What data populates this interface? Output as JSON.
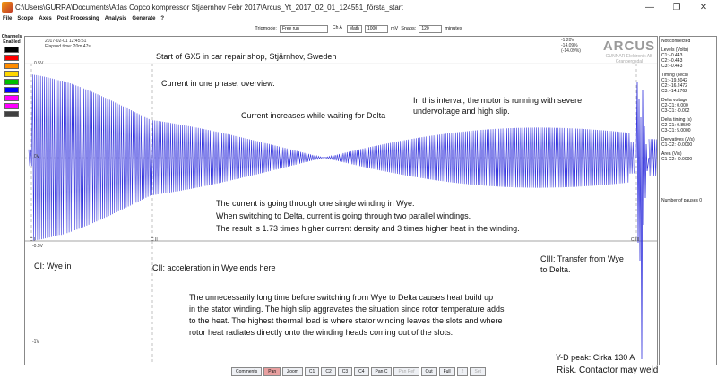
{
  "window": {
    "title": "C:\\Users\\GURRA\\Documents\\Atlas Copco kompressor Stjaernhov Febr 2017\\Arcus_Yt_2017_02_01_124551_första_start",
    "minimize": "—",
    "maximize": "❐",
    "close": "✕"
  },
  "menu": [
    "File",
    "Scope",
    "Axes",
    "Post Processing",
    "Analysis",
    "Generate",
    "?"
  ],
  "toolbar": {
    "trigmode_label": "Trigmode:",
    "trigmode_value": "Free run",
    "channel_value": "Ch A",
    "math_value": "Math",
    "level_value": "1000",
    "level_unit": "mV",
    "snaps_label": "Snaps:",
    "snaps_value": "120",
    "snaps_unit": "minutes"
  },
  "channels": {
    "header1": "Channels",
    "header2": "Enabled",
    "colors": [
      "#000000",
      "#ff0000",
      "#ff8c00",
      "#ffd700",
      "#00c000",
      "#0000ff",
      "#ff00ff",
      "#ff00ff",
      "#404040"
    ]
  },
  "plot": {
    "timestamp": "2017-02-01   12:45:51",
    "elapsed": "Elapsed time: 20m 47s",
    "scale_top": "0.5V",
    "scale_zero": "0V",
    "scale_bottom": "-0.5V",
    "scale_mid": "-1V",
    "top_right_readout_1": "-1.20V",
    "top_right_readout_2": "-14.09%",
    "top_right_readout_3": "(-14.09%)",
    "cursor_1": "C I",
    "cursor_2": "C II",
    "cursor_3": "C III",
    "signal_color": "#3333dd"
  },
  "logo": {
    "title": "ARCUS",
    "sub1": "GUNNAR Elektronik AB",
    "sub2": "Granbergsdal"
  },
  "annotations": {
    "a1": "Start of GX5 in car repair shop, Stjärnhov, Sweden",
    "a2": "Current in one phase, overview.",
    "a3": "Current increases while waiting for Delta",
    "a4_l1": "In this interval, the motor is running with severe",
    "a4_l2": "undervoltage and high slip.",
    "a5_l1": "The current is going through one single winding in Wye.",
    "a5_l2": "When switching to Delta, current is going through two parallel windings.",
    "a5_l3": "The result is 1.73 times higher current density and 3 times higher heat in the winding.",
    "ci": "CI: Wye in",
    "cii": "CII: acceleration in Wye ends here",
    "ciii_l1": "CIII: Transfer from Wye",
    "ciii_l2": "to Delta.",
    "a6_l1": "The unnecessarily long time before switching from Wye to Delta causes heat build up",
    "a6_l2": "in the stator winding. The high slip aggravates the situation since rotor temperature adds",
    "a6_l3": "to the heat. The highest thermal load is where stator winding leaves the slots and where",
    "a6_l4": "rotor heat radiates directly onto the winding heads coming out of the slots.",
    "yd_peak": "Y-D peak: Cirka 130 A",
    "risk": "Risk. Contactor may weld"
  },
  "rpanel": {
    "status": "Not connected",
    "levels_title": "Levels (Volts)",
    "levels": [
      "C1: -0.443",
      "C2: -0.443",
      "C3: -0.443"
    ],
    "timing_title": "Timing (secs)",
    "timing": [
      "C1: -19.3042",
      "C2: -16.2472",
      "C3: -14.1762"
    ],
    "delta_v_title": "Delta voltage",
    "delta_v": [
      "C2-C1: 0.000",
      "C3-C1: -0.002"
    ],
    "delta_t_title": "Delta timing (s)",
    "delta_t": [
      "C2-C1: 0.8590",
      "C3-C1: 5.0000"
    ],
    "deriv_title": "Derivatives (V/s)",
    "deriv": [
      "C1-C2: -0.0000"
    ],
    "area_title": "Area (V/s)",
    "area": [
      "C1-C2: -0.0000"
    ],
    "pauses": "Number of pauses 0"
  },
  "buttons": [
    {
      "label": "Comments",
      "state": "normal"
    },
    {
      "label": "Pan",
      "state": "active"
    },
    {
      "label": "Zoom",
      "state": "normal"
    },
    {
      "label": "C1",
      "state": "normal"
    },
    {
      "label": "C2",
      "state": "normal"
    },
    {
      "label": "C3",
      "state": "normal"
    },
    {
      "label": "C4",
      "state": "normal"
    },
    {
      "label": "Pan C",
      "state": "normal"
    },
    {
      "label": "Pan Ref",
      "state": "disabled"
    },
    {
      "label": "Out",
      "state": "normal"
    },
    {
      "label": "Full",
      "state": "normal"
    },
    {
      "label": "2",
      "state": "disabled"
    },
    {
      "label": "Set",
      "state": "disabled"
    }
  ]
}
